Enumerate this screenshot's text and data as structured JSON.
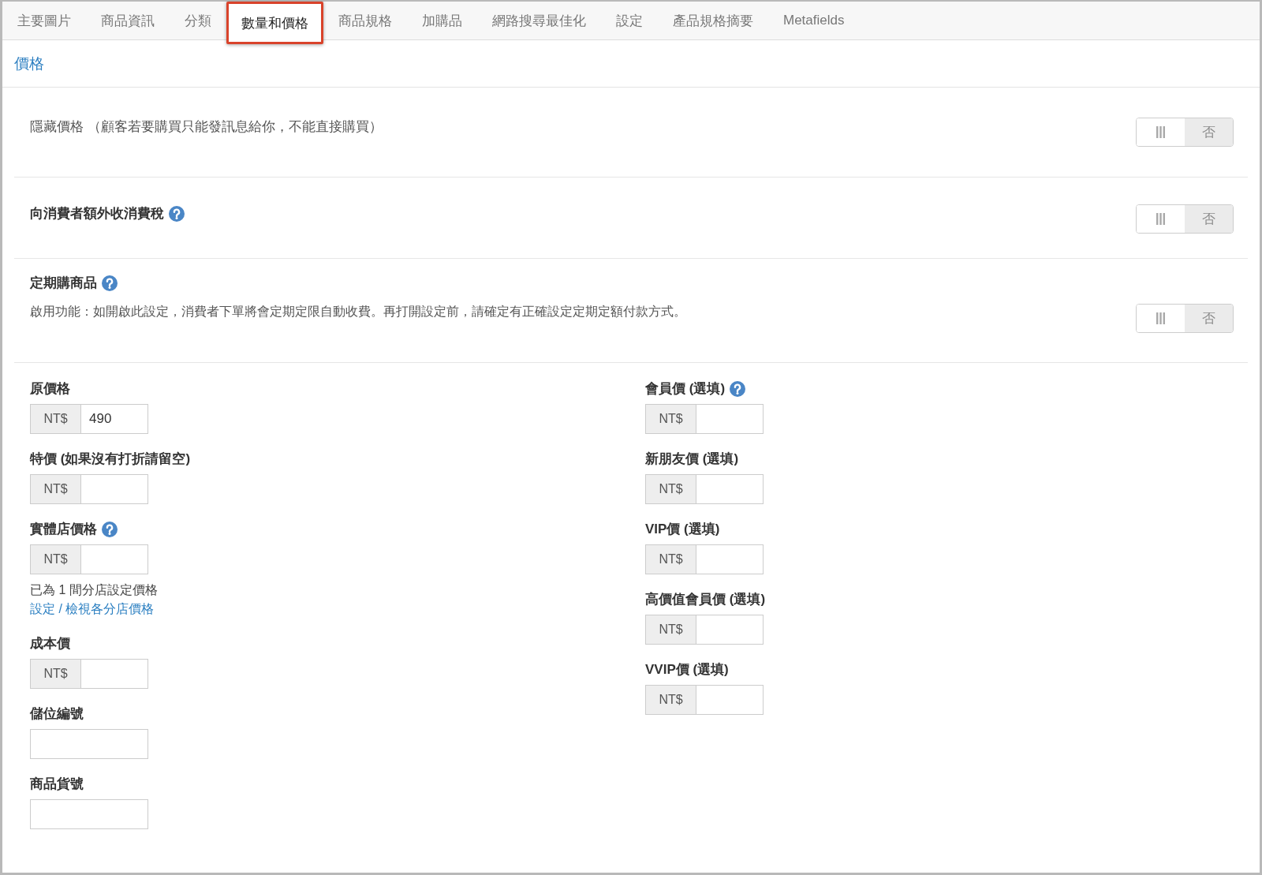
{
  "tabs": [
    {
      "label": "主要圖片",
      "selected": false
    },
    {
      "label": "商品資訊",
      "selected": false
    },
    {
      "label": "分類",
      "selected": false
    },
    {
      "label": "數量和價格",
      "selected": true
    },
    {
      "label": "商品規格",
      "selected": false
    },
    {
      "label": "加購品",
      "selected": false
    },
    {
      "label": "網路搜尋最佳化",
      "selected": false
    },
    {
      "label": "設定",
      "selected": false
    },
    {
      "label": "產品規格摘要",
      "selected": false
    },
    {
      "label": "Metafields",
      "selected": false
    }
  ],
  "section": {
    "title": "價格"
  },
  "settings": [
    {
      "kind": "plain",
      "label": "隱藏價格 （顧客若要購買只能發訊息給你，不能直接購買）",
      "help": false,
      "toggle": {
        "on": false,
        "label": "否"
      }
    },
    {
      "kind": "heading",
      "label": "向消費者額外收消費稅",
      "help": true,
      "toggle": {
        "on": false,
        "label": "否"
      }
    },
    {
      "kind": "heading",
      "label": "定期購商品",
      "help": true,
      "description": "啟用功能：如開啟此設定，消費者下單將會定期定限自動收費。再打開設定前，請確定有正確設定定期定額付款方式。",
      "toggle": {
        "on": false,
        "label": "否"
      }
    }
  ],
  "price_fields": {
    "left": [
      {
        "label": "原價格",
        "help": false,
        "prefix": "NT$",
        "value": "490"
      },
      {
        "label": "特價 (如果沒有打折請留空)",
        "help": false,
        "prefix": "NT$"
      },
      {
        "label": "實體店價格",
        "help": true,
        "prefix": "NT$",
        "note": "已為 1 間分店設定價格",
        "link": "設定 / 檢視各分店價格"
      },
      {
        "label": "成本價",
        "help": false,
        "prefix": "NT$"
      },
      {
        "label": "儲位編號",
        "help": false
      },
      {
        "label": "商品貨號",
        "help": false
      }
    ],
    "right": [
      {
        "label": "會員價 (選填)",
        "help": true,
        "prefix": "NT$"
      },
      {
        "label": "新朋友價 (選填)",
        "help": false,
        "prefix": "NT$"
      },
      {
        "label": "VIP價 (選填)",
        "help": false,
        "prefix": "NT$"
      },
      {
        "label": "高價值會員價 (選填)",
        "help": false,
        "prefix": "NT$"
      },
      {
        "label": "VVIP價 (選填)",
        "help": false,
        "prefix": "NT$"
      }
    ]
  }
}
